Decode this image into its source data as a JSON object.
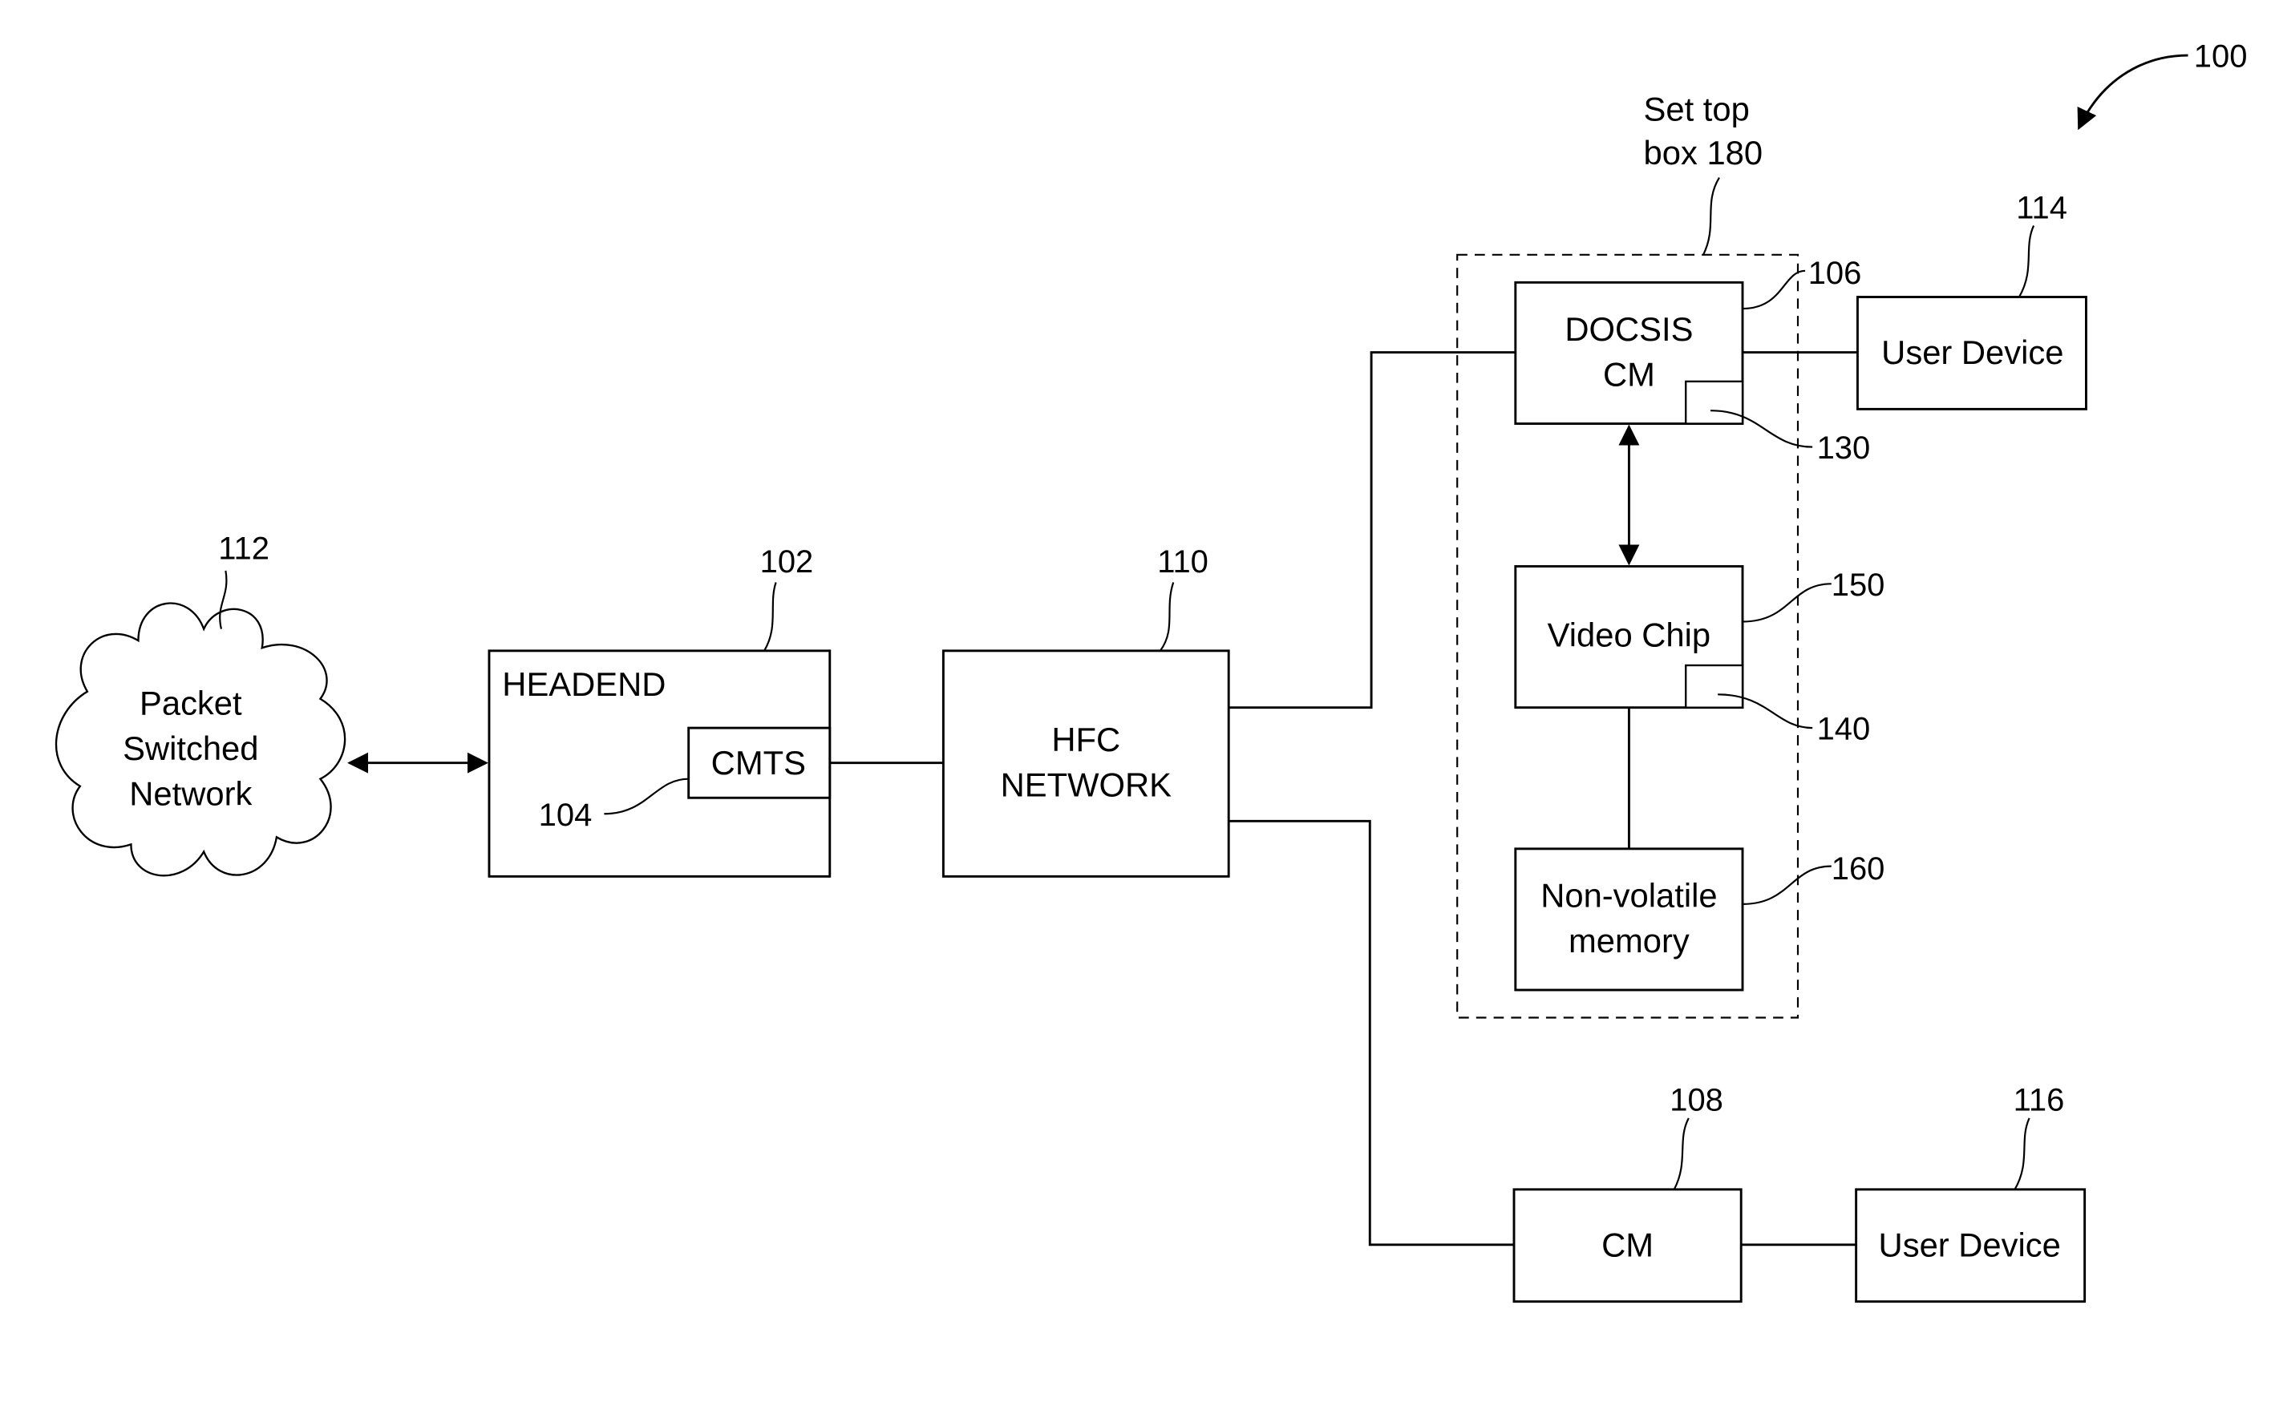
{
  "figure": {
    "reference": "100",
    "colors": {
      "line": "#000000",
      "background": "#ffffff"
    }
  },
  "nodes": {
    "packet_network": {
      "ref": "112",
      "lines": [
        "Packet",
        "Switched",
        "Network"
      ]
    },
    "headend": {
      "ref": "102",
      "label": "HEADEND"
    },
    "cmts": {
      "ref": "104",
      "label": "CMTS"
    },
    "hfc": {
      "ref": "110",
      "lines": [
        "HFC",
        "NETWORK"
      ]
    },
    "set_top_box": {
      "lines": [
        "Set top",
        "box 180"
      ]
    },
    "docsis_cm": {
      "ref": "106",
      "lines": [
        "DOCSIS",
        "CM"
      ]
    },
    "docsis_sub": {
      "ref": "130"
    },
    "video_chip": {
      "ref": "150",
      "label": "Video Chip"
    },
    "video_sub": {
      "ref": "140"
    },
    "nvm": {
      "ref": "160",
      "lines": [
        "Non-volatile",
        "memory"
      ]
    },
    "user_device_1": {
      "ref": "114",
      "label": "User Device"
    },
    "cm": {
      "ref": "108",
      "label": "CM"
    },
    "user_device_2": {
      "ref": "116",
      "label": "User Device"
    }
  }
}
